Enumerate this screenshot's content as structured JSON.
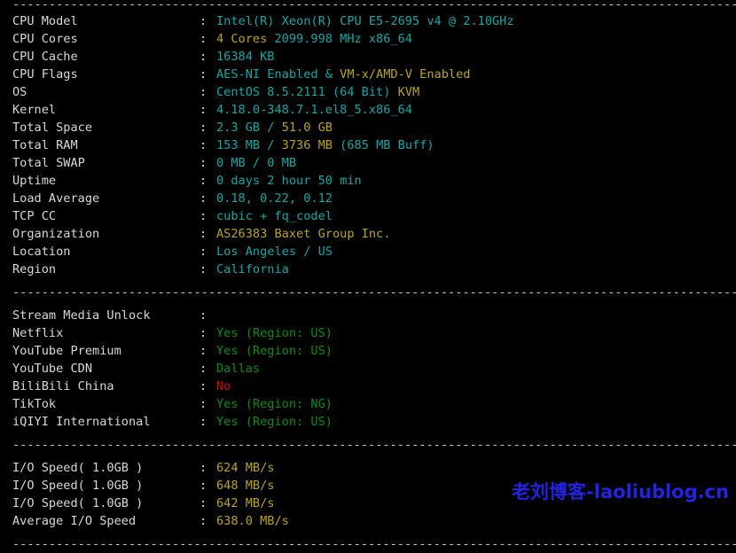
{
  "terminal": {
    "separator_line": "----------------------------------------------------------------------",
    "watermark": "老刘博客-laoliublog.cn",
    "colon": ":",
    "colors": {
      "background": "#000000",
      "label": "#d8d8d8",
      "cyan": "#17a6a6",
      "yellow": "#b9a424",
      "green": "#0a8c14",
      "red": "#c51010",
      "watermark": "#2323e0"
    },
    "sections": [
      {
        "name": "system-info",
        "rows": [
          {
            "label": "CPU Model",
            "parts": [
              {
                "text": "Intel(R) Xeon(R) CPU E5-2695 v4 @ 2.10GHz",
                "color": "cyan"
              }
            ]
          },
          {
            "label": "CPU Cores",
            "parts": [
              {
                "text": "4 Cores ",
                "color": "yellow"
              },
              {
                "text": "2099.998 MHz x86_64",
                "color": "cyan"
              }
            ]
          },
          {
            "label": "CPU Cache",
            "parts": [
              {
                "text": "16384 KB",
                "color": "cyan"
              }
            ]
          },
          {
            "label": "CPU Flags",
            "parts": [
              {
                "text": "AES-NI Enabled & ",
                "color": "cyan"
              },
              {
                "text": "VM-x/AMD-V Enabled",
                "color": "yellow"
              }
            ]
          },
          {
            "label": "OS",
            "parts": [
              {
                "text": "CentOS 8.5.2111 (64 Bit) ",
                "color": "cyan"
              },
              {
                "text": "KVM",
                "color": "yellow"
              }
            ]
          },
          {
            "label": "Kernel",
            "parts": [
              {
                "text": "4.18.0-348.7.1.el8_5.x86_64",
                "color": "cyan"
              }
            ]
          },
          {
            "label": "Total Space",
            "parts": [
              {
                "text": "2.3 GB / ",
                "color": "cyan"
              },
              {
                "text": "51.0 GB",
                "color": "yellow"
              }
            ]
          },
          {
            "label": "Total RAM",
            "parts": [
              {
                "text": "153 MB / ",
                "color": "cyan"
              },
              {
                "text": "3736 MB ",
                "color": "yellow"
              },
              {
                "text": "(685 MB Buff)",
                "color": "cyan"
              }
            ]
          },
          {
            "label": "Total SWAP",
            "parts": [
              {
                "text": "0 MB / 0 MB",
                "color": "cyan"
              }
            ]
          },
          {
            "label": "Uptime",
            "parts": [
              {
                "text": "0 days 2 hour 50 min",
                "color": "cyan"
              }
            ]
          },
          {
            "label": "Load Average",
            "parts": [
              {
                "text": "0.18, 0.22, 0.12",
                "color": "cyan"
              }
            ]
          },
          {
            "label": "TCP CC",
            "parts": [
              {
                "text": "cubic + fq_codel",
                "color": "cyan"
              }
            ]
          },
          {
            "label": "Organization",
            "parts": [
              {
                "text": "AS26383 Baxet Group Inc.",
                "color": "yellow"
              }
            ]
          },
          {
            "label": "Location",
            "parts": [
              {
                "text": "Los Angeles / US",
                "color": "cyan"
              }
            ]
          },
          {
            "label": "Region",
            "parts": [
              {
                "text": "California",
                "color": "cyan"
              }
            ]
          }
        ]
      },
      {
        "name": "stream-media-unlock",
        "rows": [
          {
            "label": "Stream Media Unlock",
            "parts": []
          },
          {
            "label": "Netflix",
            "parts": [
              {
                "text": "Yes (Region: US)",
                "color": "green"
              }
            ]
          },
          {
            "label": "YouTube Premium",
            "parts": [
              {
                "text": "Yes (Region: US)",
                "color": "green"
              }
            ]
          },
          {
            "label": "YouTube CDN",
            "parts": [
              {
                "text": "Dallas",
                "color": "green"
              }
            ]
          },
          {
            "label": "BiliBili China",
            "parts": [
              {
                "text": "No",
                "color": "red"
              }
            ]
          },
          {
            "label": "TikTok",
            "parts": [
              {
                "text": "Yes (Region: NG)",
                "color": "green"
              }
            ]
          },
          {
            "label": "iQIYI International",
            "parts": [
              {
                "text": "Yes (Region: US)",
                "color": "green"
              }
            ]
          }
        ]
      },
      {
        "name": "io-speed",
        "rows": [
          {
            "label": "I/O Speed( 1.0GB )",
            "parts": [
              {
                "text": "624 MB/s",
                "color": "yellow"
              }
            ]
          },
          {
            "label": "I/O Speed( 1.0GB )",
            "parts": [
              {
                "text": "648 MB/s",
                "color": "yellow"
              }
            ]
          },
          {
            "label": "I/O Speed( 1.0GB )",
            "parts": [
              {
                "text": "642 MB/s",
                "color": "yellow"
              }
            ]
          },
          {
            "label": "Average I/O Speed",
            "parts": [
              {
                "text": "638.0 MB/s",
                "color": "yellow"
              }
            ]
          }
        ]
      }
    ]
  }
}
